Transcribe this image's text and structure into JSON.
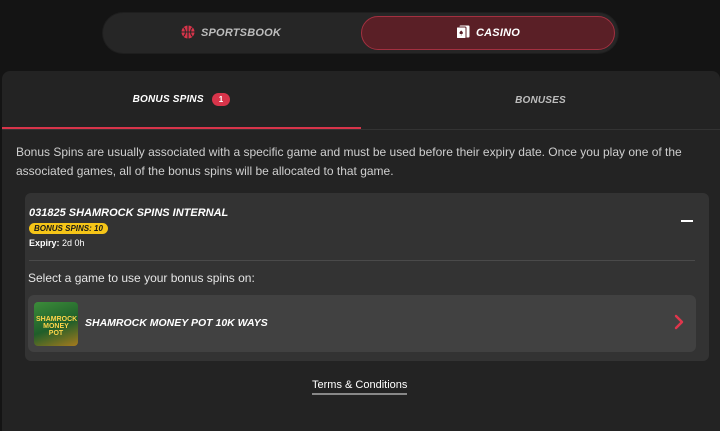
{
  "nav": {
    "sportsbook_label": "SPORTSBOOK",
    "casino_label": "CASINO",
    "sportsbook_icon": "basketball-icon",
    "casino_icon": "playing-cards-icon"
  },
  "tabs": [
    {
      "label": "BONUS SPINS",
      "badge": "1"
    },
    {
      "label": "BONUSES"
    }
  ],
  "description": "Bonus Spins are usually associated with a specific game and must be used before their expiry date. Once you play one of the associated games, all of the bonus spins will be allocated to that game.",
  "bonus_card": {
    "title": "031825 SHAMROCK SPINS INTERNAL",
    "spins_badge": "BONUS SPINS: 10",
    "expiry_label": "Expiry:",
    "expiry_value": "2d 0h",
    "collapse_icon": "minus-icon",
    "select_label": "Select a game to use your bonus spins on:",
    "game": {
      "name": "SHAMROCK MONEY POT 10K WAYS",
      "thumb_text": "SHAMROCK MONEY POT",
      "chevron_icon": "chevron-right-icon"
    }
  },
  "terms_label": "Terms & Conditions",
  "colors": {
    "accent": "#d8344a",
    "badge_yellow": "#f5c518",
    "background": "#141414",
    "panel": "#232323"
  }
}
